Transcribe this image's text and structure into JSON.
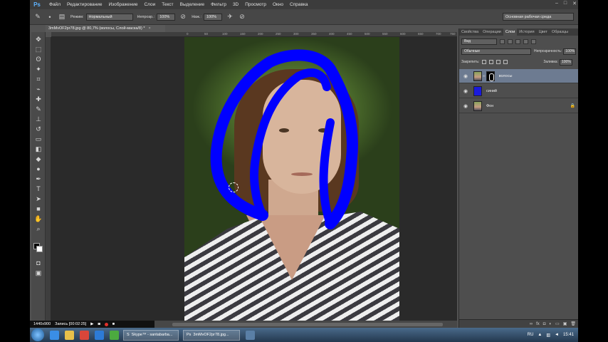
{
  "app": {
    "logo": "Ps",
    "menu": [
      "Файл",
      "Редактирование",
      "Изображение",
      "Слои",
      "Текст",
      "Выделение",
      "Фильтр",
      "3D",
      "Просмотр",
      "Окно",
      "Справка"
    ],
    "window_controls": [
      "–",
      "□",
      "✕"
    ]
  },
  "options": {
    "mode_label": "Режим:",
    "mode_value": "Нормальный",
    "opacity_label": "Непрозр.:",
    "opacity_value": "100%",
    "pressure_label": "Наж.:",
    "pressure_value": "100%",
    "workspace": "Основная рабочая среда"
  },
  "document": {
    "tab_title": "3mMvOF2pr78.jpg @ 80,7% (волосы, Слой-маска/8) *",
    "tab_close": "×"
  },
  "ruler": {
    "ticks": [
      "0",
      "50",
      "100",
      "150",
      "200",
      "250",
      "300",
      "350",
      "400",
      "450",
      "500",
      "550",
      "600",
      "650",
      "700",
      "750",
      "800",
      "850"
    ]
  },
  "status": {
    "resolution": "1440x900",
    "recording": "Запись [00:02:25]"
  },
  "panel": {
    "tabs": [
      "Свойства",
      "Операции",
      "Слои",
      "История",
      "Цвет",
      "Образцы"
    ],
    "active_tab": "Слои",
    "filter_label": "Вид",
    "blend_mode": "Обычные",
    "opacity_label": "Непрозрачность:",
    "opacity_value": "100%",
    "lock_label": "Закрепить:",
    "fill_label": "Заливка:",
    "fill_value": "100%",
    "layers": [
      {
        "name": "волосы",
        "selected": true,
        "thumb": "photo",
        "has_mask": true
      },
      {
        "name": "синий",
        "selected": false,
        "thumb": "blue",
        "has_mask": false
      },
      {
        "name": "Фон",
        "selected": false,
        "thumb": "photo",
        "has_mask": false,
        "locked": true
      }
    ],
    "footer_icons": [
      "link-icon",
      "fx-icon",
      "mask-icon",
      "adjustment-icon",
      "group-icon",
      "new-layer-icon",
      "trash-icon"
    ]
  },
  "taskbar": {
    "tasks": [
      "Skype™ - santabarba...",
      "3mMvOF2pr78.jpg..."
    ],
    "language": "RU",
    "time": "15:41"
  },
  "colors": {
    "mask_stroke": "#0000ff",
    "accent": "#6d7b91"
  }
}
